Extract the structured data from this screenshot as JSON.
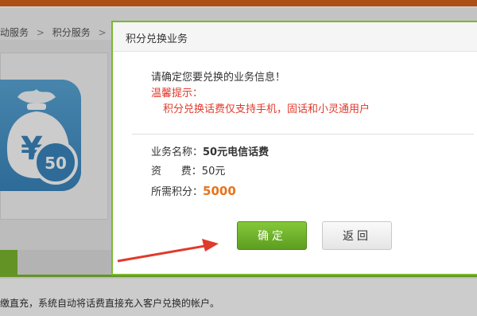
{
  "breadcrumb": [
    "动服务",
    "积分服务",
    "积分"
  ],
  "breadcrumb_sep": ">",
  "product_icon": {
    "badge_value": "50",
    "currency_symbol": "¥"
  },
  "footer_text": "缴直充，系统自动将话费直接充入客户兑换的帐户。",
  "modal": {
    "title": "积分兑换业务",
    "confirm_prompt": "请确定您要兑换的业务信息！",
    "tip_label": "温馨提示：",
    "tip_text": "积分兑换话费仅支持手机，固话和小灵通用户",
    "fields": {
      "name_label": "业务名称：",
      "name_value": "50元电信话费",
      "fee_label": "资      费：",
      "fee_value": "50元",
      "points_label": "所需积分：",
      "points_value": "5000"
    },
    "confirm_button": "确定",
    "back_button": "返回"
  },
  "colors": {
    "accent_green": "#7cb82f",
    "alert_red": "#e03a2c",
    "points_orange": "#e8731a",
    "top_bar_orange": "#d9641c",
    "annotation_arrow": "#e03a2c"
  }
}
